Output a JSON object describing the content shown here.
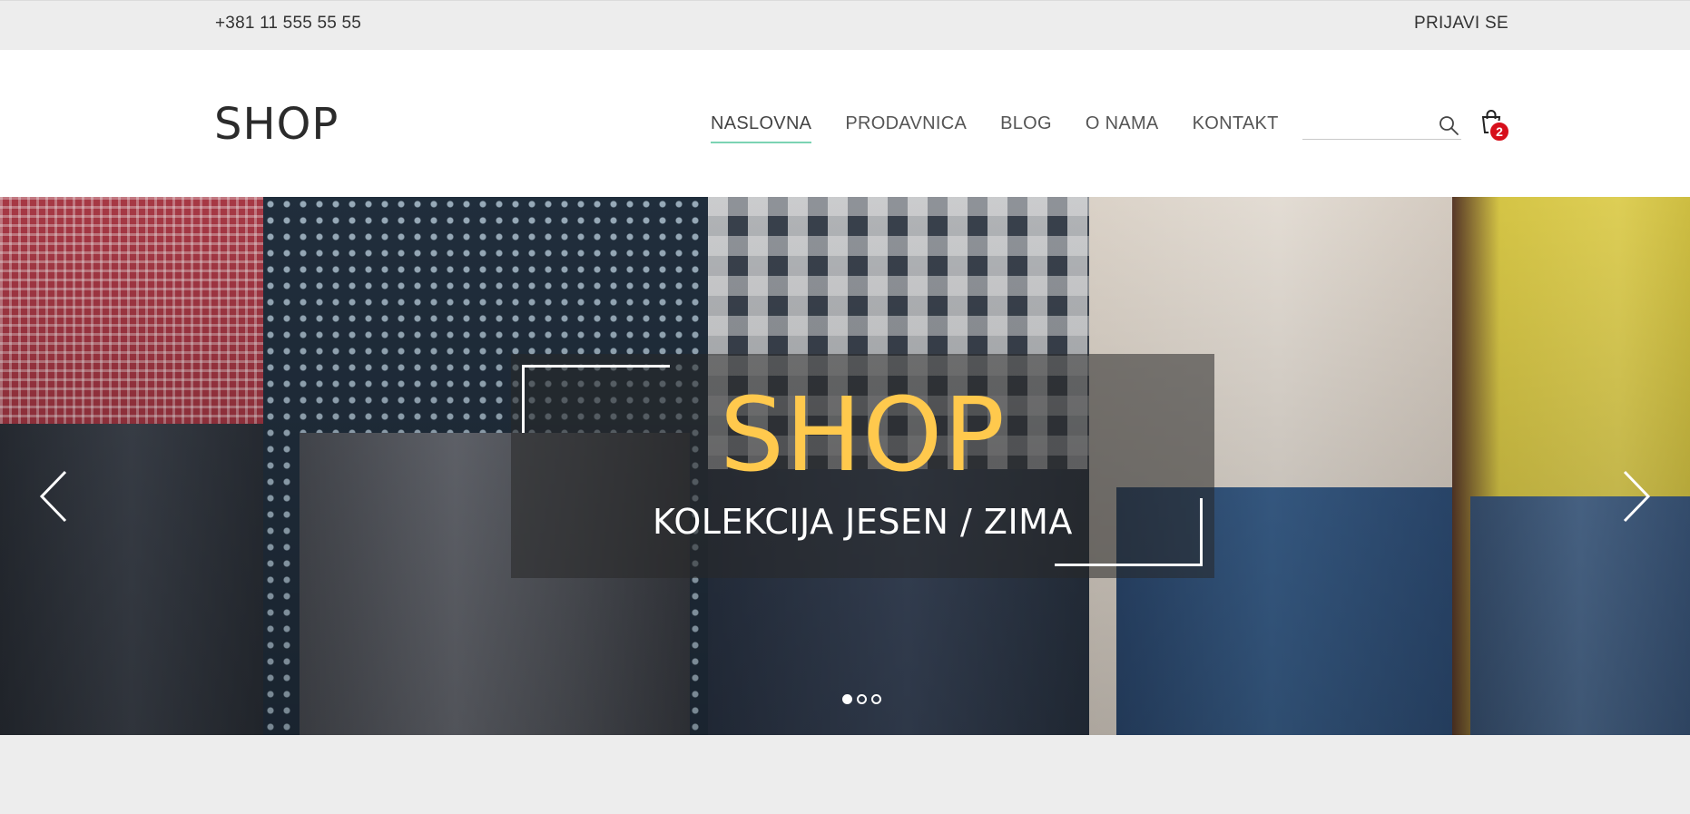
{
  "topbar": {
    "phone": "+381 11 555 55 55",
    "login": "PRIJAVI SE"
  },
  "header": {
    "logo": "SHOP",
    "nav": [
      {
        "label": "NASLOVNA",
        "active": true
      },
      {
        "label": "PRODAVNICA",
        "active": false
      },
      {
        "label": "BLOG",
        "active": false
      },
      {
        "label": "O NAMA",
        "active": false
      },
      {
        "label": "KONTAKT",
        "active": false
      }
    ],
    "search": {
      "placeholder": "",
      "value": "",
      "icon": "search-icon"
    },
    "cart": {
      "icon": "shopping-bag-icon",
      "count": "2",
      "badge_color": "#d70f1b"
    }
  },
  "hero": {
    "title": "SHOP",
    "subtitle": "KOLEKCIJA JESEN / ZIMA",
    "title_color": "#ffc94d",
    "prev_icon": "chevron-left-icon",
    "next_icon": "chevron-right-icon",
    "slides": 3,
    "active_slide": 1
  },
  "colors": {
    "nav_active_underline": "#7bd3b3",
    "topbar_bg": "#ededed"
  }
}
